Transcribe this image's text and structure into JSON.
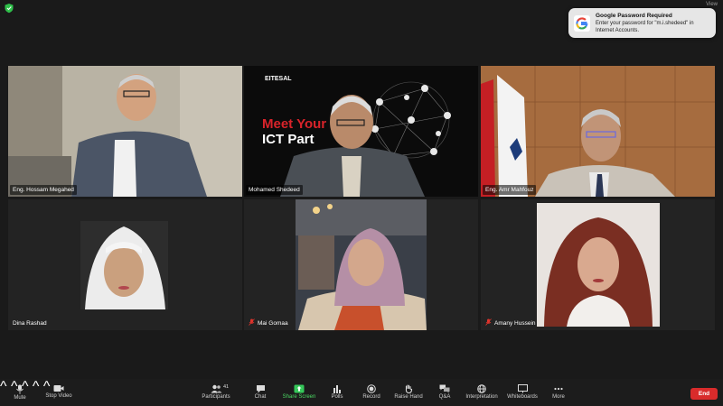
{
  "notification": {
    "title": "Google Password Required",
    "body": "Enter your password for \"m.i.shedeed\" in Internet Accounts."
  },
  "status": {
    "top_right": "View"
  },
  "participants": [
    {
      "name": "Eng. Hossam Megahed",
      "active_speaker": true,
      "muted": false
    },
    {
      "name": "Mohamed Shedeed",
      "active_speaker": false,
      "muted": false
    },
    {
      "name": "Eng. Amr Mahfouz",
      "active_speaker": false,
      "muted": false
    },
    {
      "name": "Dina Rashad",
      "active_speaker": false,
      "muted": false
    },
    {
      "name": "Mai Gomaa",
      "active_speaker": false,
      "muted": true
    },
    {
      "name": "Amany Hussein",
      "active_speaker": false,
      "muted": true
    }
  ],
  "background_banner": {
    "brand": "EITESAL",
    "headline_1": "Meet Your",
    "headline_2": "ICT Part"
  },
  "toolbar": {
    "mute": "Mute",
    "stop_video": "Stop Video",
    "participants": "Participants",
    "participants_count": "41",
    "chat": "Chat",
    "share_screen": "Share Screen",
    "polls": "Polls",
    "record": "Record",
    "raise_hand": "Raise Hand",
    "qa": "Q&A",
    "interpretation": "Interpretation",
    "whiteboards": "Whiteboards",
    "more": "More",
    "end": "End"
  },
  "colors": {
    "active_speaker_border": "#3cc04a",
    "share_screen_green": "#4cd964",
    "end_button": "#d92b2b",
    "muted_mic_red": "#e0342c"
  }
}
